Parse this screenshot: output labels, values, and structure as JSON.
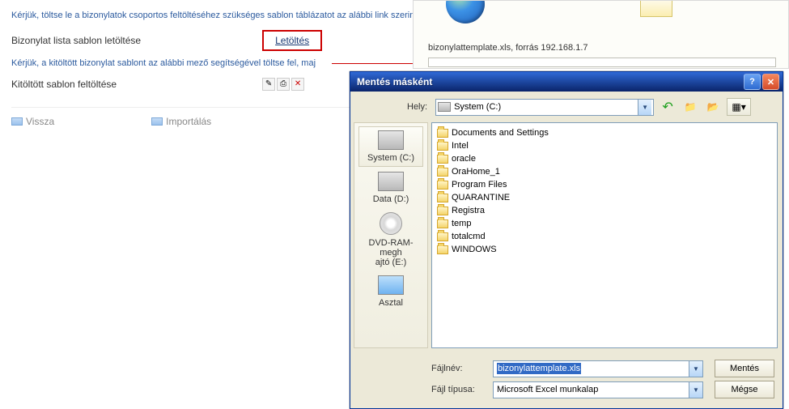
{
  "page": {
    "instruction1": "Kérjük, töltse le a bizonylatok csoportos feltöltéséhez szükséges sablon táblázatot az alábbi link szerint!",
    "row1_label": "Bizonylat lista sablon letöltése",
    "download_link": "Letöltés",
    "instruction2": "Kérjük, a kitöltött bizonylat sablont az alábbi mező segítségével töltse fel, maj",
    "row2_label": "Kitöltött sablon feltöltése",
    "nav_back": "Vissza",
    "nav_import": "Importálás"
  },
  "download_top": {
    "file_label": "bizonylattemplate.xls, forrás 192.168.1.7"
  },
  "dialog": {
    "title": "Mentés másként",
    "location_label": "Hely:",
    "location_value": "System (C:)",
    "places": [
      {
        "label": "System (C:)"
      },
      {
        "label": "Data (D:)"
      },
      {
        "label": "DVD-RAM-megh\najtó (E:)"
      },
      {
        "label": "Asztal"
      }
    ],
    "files": [
      "Documents and Settings",
      "Intel",
      "oracle",
      "OraHome_1",
      "Program Files",
      "QUARANTINE",
      "Registra",
      "temp",
      "totalcmd",
      "WINDOWS"
    ],
    "filename_label": "Fájlnév:",
    "filename_value": "bizonylattemplate.xls",
    "filetype_label": "Fájl típusa:",
    "filetype_value": "Microsoft Excel munkalap",
    "btn_save": "Mentés",
    "btn_cancel": "Mégse"
  }
}
